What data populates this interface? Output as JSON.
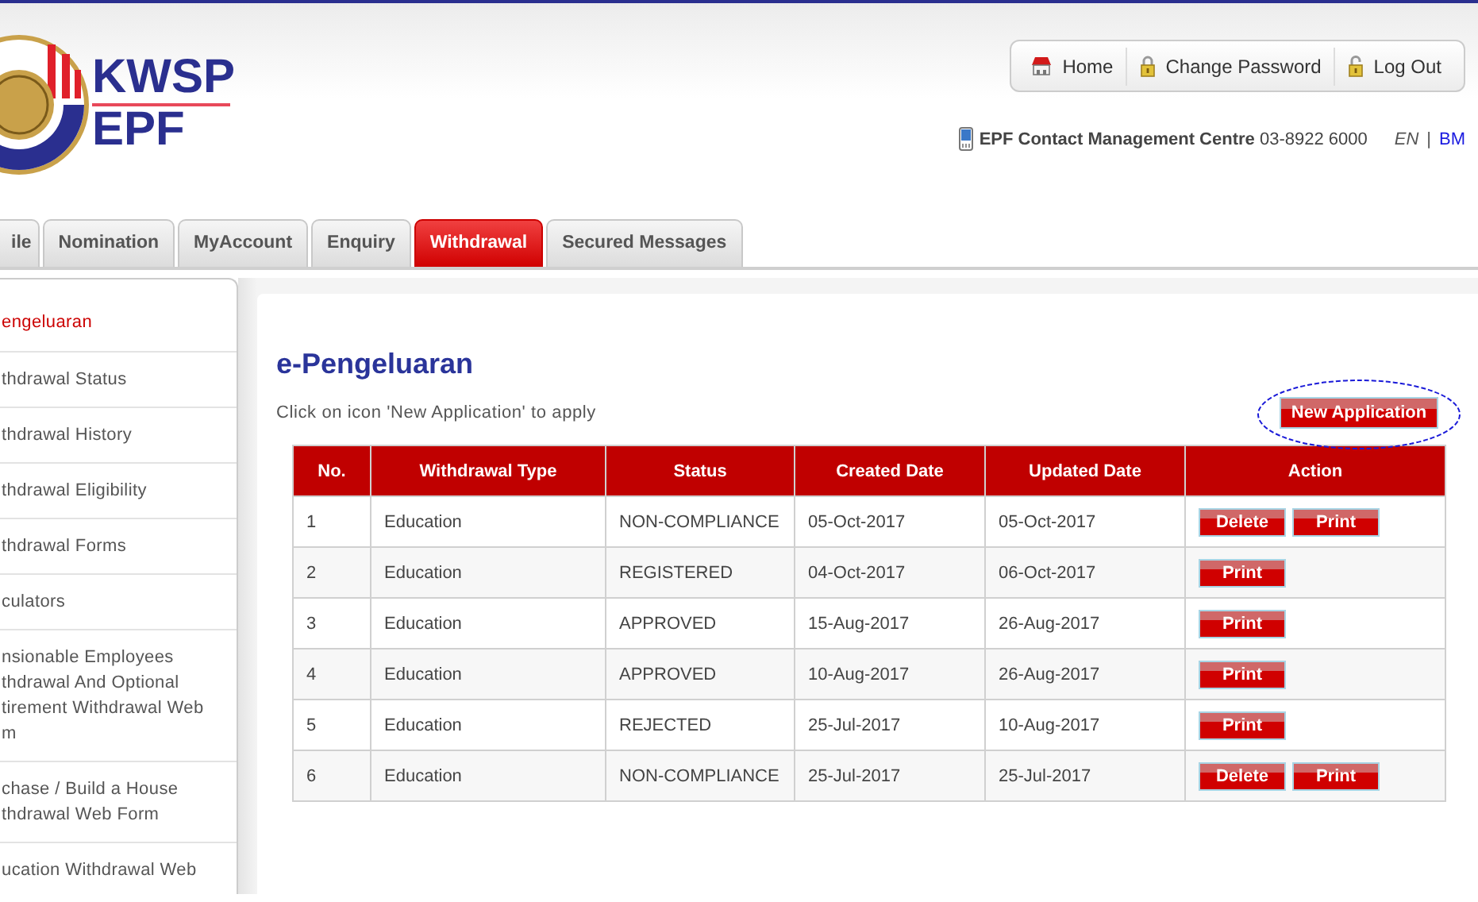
{
  "header": {
    "logo_lines": [
      "KWSP",
      "EPF"
    ],
    "nav": [
      {
        "label": "Home",
        "kind": "home"
      },
      {
        "label": "Change Password",
        "kind": "lock"
      },
      {
        "label": "Log Out",
        "kind": "unlock"
      }
    ],
    "contact": {
      "label": "EPF Contact Management Centre",
      "phone": "03-8922 6000"
    },
    "languages": [
      {
        "label": "EN",
        "selected": true
      },
      {
        "label": "BM",
        "selected": false
      }
    ],
    "language_separator": "|"
  },
  "tabs": [
    {
      "label": "ile",
      "selected": false
    },
    {
      "label": "Nomination",
      "selected": false
    },
    {
      "label": "MyAccount",
      "selected": false
    },
    {
      "label": "Enquiry",
      "selected": false
    },
    {
      "label": "Withdrawal",
      "selected": true
    },
    {
      "label": "Secured Messages",
      "selected": false
    }
  ],
  "sidebar": {
    "items": [
      {
        "lines": [
          "engeluaran"
        ],
        "selected": true
      },
      {
        "lines": [
          "thdrawal Status"
        ],
        "selected": false
      },
      {
        "lines": [
          "thdrawal History"
        ],
        "selected": false
      },
      {
        "lines": [
          "thdrawal Eligibility"
        ],
        "selected": false
      },
      {
        "lines": [
          "thdrawal Forms"
        ],
        "selected": false
      },
      {
        "lines": [
          "culators"
        ],
        "selected": false
      },
      {
        "lines": [
          "nsionable Employees",
          "thdrawal And Optional",
          "tirement Withdrawal Web",
          "m"
        ],
        "selected": false
      },
      {
        "lines": [
          "chase / Build a House",
          "thdrawal Web Form"
        ],
        "selected": false
      },
      {
        "lines": [
          "ucation Withdrawal Web"
        ],
        "selected": false
      }
    ]
  },
  "content": {
    "title": "e-Pengeluaran",
    "instruction": "Click on icon 'New Application' to apply",
    "new_application": {
      "label": "New Application",
      "circled": true
    },
    "table": {
      "columns": [
        "No.",
        "Withdrawal Type",
        "Status",
        "Created Date",
        "Updated Date",
        "Action"
      ],
      "rows": [
        {
          "cells": [
            "1",
            "Education",
            "NON-COMPLIANCE",
            "05-Oct-2017",
            "05-Oct-2017"
          ],
          "actions": [
            "Delete",
            "Print"
          ]
        },
        {
          "cells": [
            "2",
            "Education",
            "REGISTERED",
            "04-Oct-2017",
            "06-Oct-2017"
          ],
          "actions": [
            "Print"
          ]
        },
        {
          "cells": [
            "3",
            "Education",
            "APPROVED",
            "15-Aug-2017",
            "26-Aug-2017"
          ],
          "actions": [
            "Print"
          ]
        },
        {
          "cells": [
            "4",
            "Education",
            "APPROVED",
            "10-Aug-2017",
            "26-Aug-2017"
          ],
          "actions": [
            "Print"
          ]
        },
        {
          "cells": [
            "5",
            "Education",
            "REJECTED",
            "25-Jul-2017",
            "10-Aug-2017"
          ],
          "actions": [
            "Print"
          ]
        },
        {
          "cells": [
            "6",
            "Education",
            "NON-COMPLIANCE",
            "25-Jul-2017",
            "25-Jul-2017"
          ],
          "actions": [
            "Delete",
            "Print"
          ]
        }
      ]
    }
  }
}
